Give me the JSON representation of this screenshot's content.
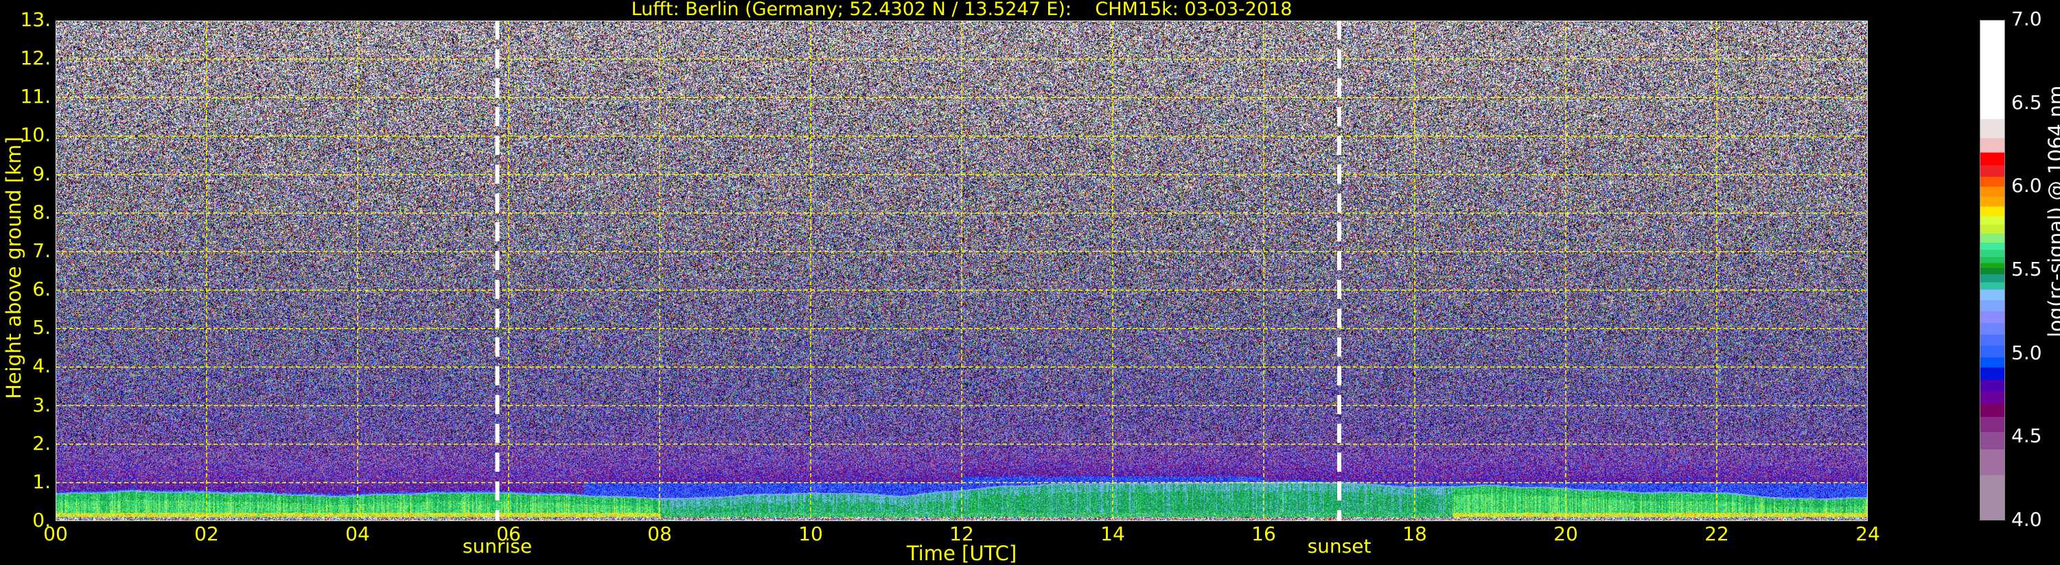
{
  "title": "Lufft: Berlin (Germany; 52.4302 N / 13.5247 E):    CHM15k: 03-03-2018",
  "chart_data": {
    "type": "heatmap",
    "title": "Lufft: Berlin (Germany; 52.4302 N / 13.5247 E):    CHM15k: 03-03-2018",
    "xlabel": "Time [UTC]",
    "ylabel": "Height above ground [km]",
    "xlim": [
      0,
      24
    ],
    "ylim": [
      0,
      13
    ],
    "x_ticks": [
      "00",
      "02",
      "04",
      "06",
      "08",
      "10",
      "12",
      "14",
      "16",
      "18",
      "20",
      "22",
      "24"
    ],
    "y_ticks": [
      "0.",
      "1.",
      "2.",
      "3.",
      "4.",
      "5.",
      "6.",
      "7.",
      "8.",
      "9.",
      "10.",
      "11.",
      "12.",
      "13."
    ],
    "grid": true,
    "grid_color": "#ffff00",
    "text_color": "#ffff00",
    "annotations": [
      {
        "label": "sunrise",
        "time_h": 5.85,
        "color": "#ffffff"
      },
      {
        "label": "sunset",
        "time_h": 17.0,
        "color": "#ffffff"
      }
    ],
    "boundary_layer_top_km": {
      "time_h": [
        0,
        1,
        2,
        3,
        3.6,
        4.5,
        5.5,
        6.5,
        7.5,
        8.3,
        9.5,
        10.5,
        11.2,
        12,
        12.6,
        13.5,
        14.5,
        16,
        17,
        18,
        19,
        20,
        21,
        22,
        23,
        24
      ],
      "height_km": [
        0.68,
        0.75,
        0.72,
        0.68,
        0.62,
        0.68,
        0.72,
        0.68,
        0.6,
        0.55,
        0.68,
        0.7,
        0.62,
        0.78,
        0.88,
        0.95,
        0.95,
        0.98,
        0.97,
        0.85,
        0.9,
        0.82,
        0.72,
        0.72,
        0.55,
        0.58
      ]
    },
    "colorbar": {
      "label": "log(rc-signal) @ 1064 nm",
      "range": [
        4.0,
        7.0
      ],
      "ticks": [
        "4.0",
        "4.5",
        "5.0",
        "5.5",
        "6.0",
        "6.5",
        "7.0"
      ],
      "below_color": "#000000",
      "levels": [
        {
          "from": 4.0,
          "color": "#a78ca8"
        },
        {
          "from": 4.277,
          "color": "#a070a0"
        },
        {
          "from": 4.432,
          "color": "#8f4d96"
        },
        {
          "from": 4.536,
          "color": "#862c86"
        },
        {
          "from": 4.627,
          "color": "#7a0066"
        },
        {
          "from": 4.705,
          "color": "#6b009c"
        },
        {
          "from": 4.778,
          "color": "#4e00b0"
        },
        {
          "from": 4.849,
          "color": "#0014e0"
        },
        {
          "from": 4.923,
          "color": "#0055ff"
        },
        {
          "from": 4.983,
          "color": "#3366ff"
        },
        {
          "from": 5.055,
          "color": "#4c72ff"
        },
        {
          "from": 5.12,
          "color": "#6f84ff"
        },
        {
          "from": 5.189,
          "color": "#8a8cff"
        },
        {
          "from": 5.26,
          "color": "#7ea6ff"
        },
        {
          "from": 5.325,
          "color": "#86c0ff"
        },
        {
          "from": 5.39,
          "color": "#2fc3a3"
        },
        {
          "from": 5.433,
          "color": "#1c9e83"
        },
        {
          "from": 5.481,
          "color": "#0e8b2e"
        },
        {
          "from": 5.519,
          "color": "#17a614"
        },
        {
          "from": 5.548,
          "color": "#22c15a"
        },
        {
          "from": 5.584,
          "color": "#2fd480"
        },
        {
          "from": 5.628,
          "color": "#40e89a"
        },
        {
          "from": 5.671,
          "color": "#88f078"
        },
        {
          "from": 5.725,
          "color": "#c8f032"
        },
        {
          "from": 5.779,
          "color": "#d8ff3a"
        },
        {
          "from": 5.829,
          "color": "#ffe800"
        },
        {
          "from": 5.887,
          "color": "#ffaa00"
        },
        {
          "from": 5.947,
          "color": "#ff9000"
        },
        {
          "from": 6.006,
          "color": "#ff5a00"
        },
        {
          "from": 6.066,
          "color": "#ee2028"
        },
        {
          "from": 6.135,
          "color": "#ff0000"
        },
        {
          "from": 6.211,
          "color": "#f0c0c0"
        },
        {
          "from": 6.298,
          "color": "#eae0e0"
        },
        {
          "from": 6.412,
          "color": "#ffffff"
        }
      ]
    }
  }
}
